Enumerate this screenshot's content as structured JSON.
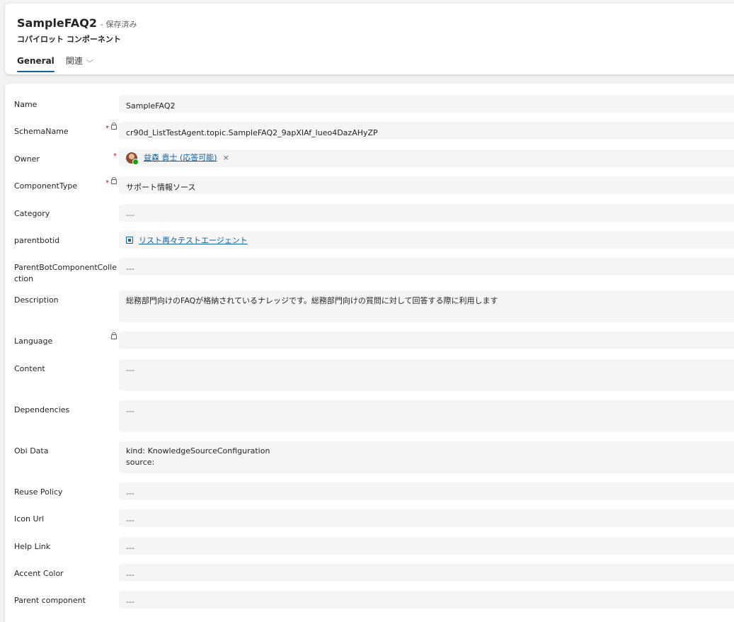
{
  "header": {
    "title": "SampleFAQ2",
    "saved_status": "- 保存済み",
    "entity_type": "コパイロット コンポーネント",
    "tabs": [
      {
        "label": "General"
      },
      {
        "label": "関連"
      }
    ]
  },
  "form": {
    "name": {
      "label": "Name",
      "value": "SampleFAQ2"
    },
    "schema_name": {
      "label": "SchemaName",
      "value": "cr90d_ListTestAgent.topic.SampleFAQ2_9apXIAf_lueo4DazAHyZP"
    },
    "owner": {
      "label": "Owner",
      "value": "益森 貴士 (応答可能)",
      "remove": "×"
    },
    "component_type": {
      "label": "ComponentType",
      "value": "サポート情報ソース"
    },
    "category": {
      "label": "Category",
      "value": "---"
    },
    "parentbotid": {
      "label": "parentbotid",
      "value": "リスト再々テストエージェント"
    },
    "parent_collection": {
      "label": "ParentBotComponentCollection",
      "value": "---"
    },
    "description": {
      "label": "Description",
      "value": "総務部門向けのFAQが格納されているナレッジです。総務部門向けの質問に対して回答する際に利用します"
    },
    "language": {
      "label": "Language",
      "value": ""
    },
    "content": {
      "label": "Content",
      "value": "---"
    },
    "dependencies": {
      "label": "Dependencies",
      "value": "---"
    },
    "obi_data": {
      "label": "Obi Data",
      "value": "kind: KnowledgeSourceConfiguration\nsource:"
    },
    "reuse_policy": {
      "label": "Reuse Policy",
      "value": "---"
    },
    "icon_url": {
      "label": "Icon Url",
      "value": "---"
    },
    "help_link": {
      "label": "Help Link",
      "value": "---"
    },
    "accent_color": {
      "label": "Accent Color",
      "value": "---"
    },
    "parent_component": {
      "label": "Parent component",
      "value": "---"
    },
    "required_mark": "*"
  }
}
